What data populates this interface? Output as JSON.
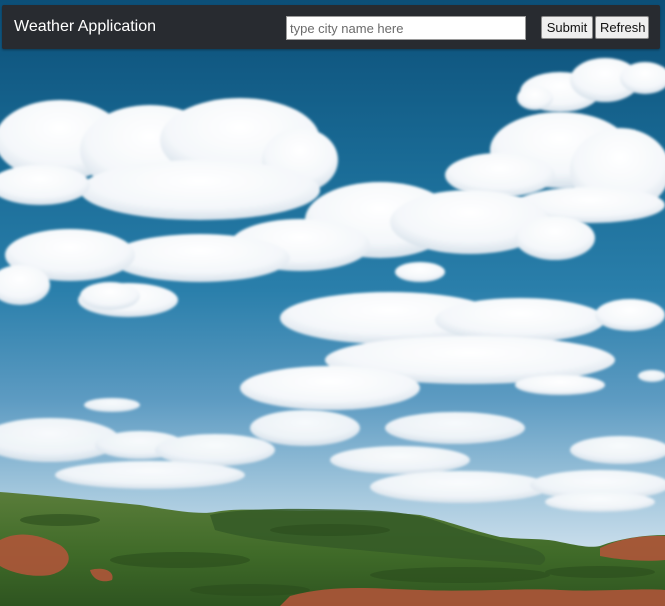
{
  "app": {
    "title": "Weather Application"
  },
  "search": {
    "placeholder": "type city name here",
    "value": ""
  },
  "buttons": {
    "submit_label": "Submit",
    "refresh_label": "Refresh"
  },
  "colors": {
    "navbar_background": "#282b30",
    "navbar_text": "#ffffff",
    "sky_top": "#0c4f78",
    "sky_bottom": "#d9e6f0",
    "vegetation": "#3d6b2a",
    "red_earth": "#b5553a"
  },
  "background_image": {
    "subject": "blue sky with white cumulus clouds over green hills with red earth"
  }
}
